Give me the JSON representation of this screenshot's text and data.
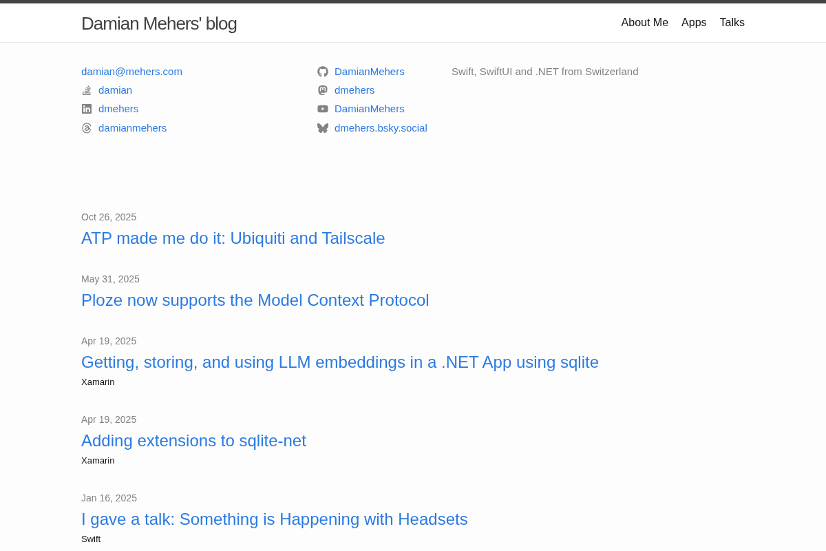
{
  "header": {
    "site_title": "Damian Mehers' blog",
    "nav": [
      "About Me",
      "Apps",
      "Talks"
    ]
  },
  "social": {
    "columns": [
      [
        {
          "kind": "email",
          "text": "damian@mehers.com"
        },
        {
          "kind": "stackoverflow",
          "text": "damian"
        },
        {
          "kind": "linkedin",
          "text": "dmehers"
        },
        {
          "kind": "threads",
          "text": "damianmehers"
        }
      ],
      [
        {
          "kind": "github",
          "text": "DamianMehers"
        },
        {
          "kind": "mastodon",
          "text": "dmehers"
        },
        {
          "kind": "youtube",
          "text": "DamianMehers"
        },
        {
          "kind": "bluesky",
          "text": "dmehers.bsky.social"
        }
      ]
    ],
    "tagline": "Swift, SwiftUI and .NET from Switzerland"
  },
  "posts": [
    {
      "date": "Oct 26, 2025",
      "title": "ATP made me do it: Ubiquiti and Tailscale"
    },
    {
      "date": "May 31, 2025",
      "title": "Ploze now supports the Model Context Protocol"
    },
    {
      "date": "Apr 19, 2025",
      "title": "Getting, storing, and using LLM embeddings in a .NET App using sqlite",
      "tags": [
        "Xamarin"
      ]
    },
    {
      "date": "Apr 19, 2025",
      "title": "Adding extensions to sqlite-net",
      "tags": [
        "Xamarin"
      ]
    },
    {
      "date": "Jan 16, 2025",
      "title": "I gave a talk: Something is Happening with Headsets",
      "tags": [
        "Swift"
      ]
    }
  ]
}
